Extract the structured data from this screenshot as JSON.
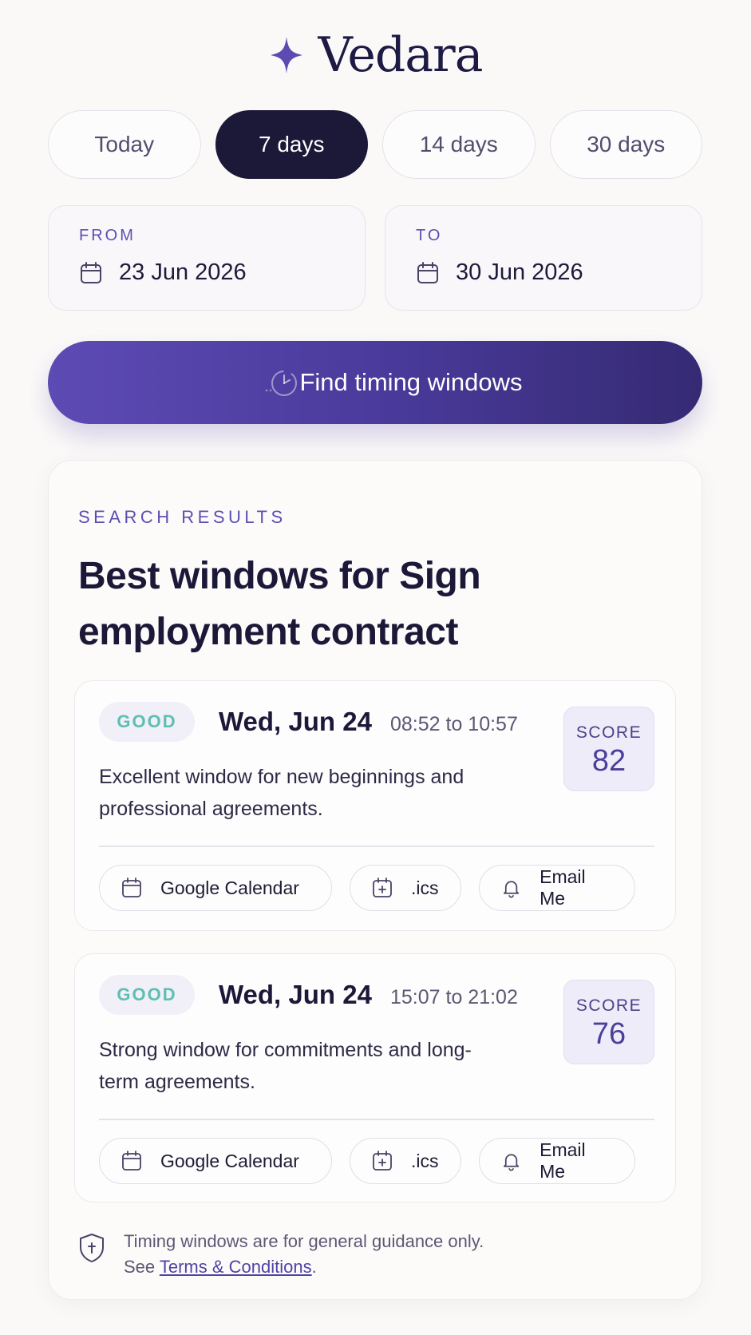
{
  "brand": {
    "name": "Vedara",
    "icon": "sparkle-star-icon",
    "accent": "#5b4bb2"
  },
  "range_tabs": [
    {
      "label": "Today",
      "active": false
    },
    {
      "label": "7 days",
      "active": true
    },
    {
      "label": "14 days",
      "active": false
    },
    {
      "label": "30 days",
      "active": false
    }
  ],
  "date_range": {
    "from": {
      "label": "FROM",
      "value": "23 Jun 2026",
      "icon": "calendar-icon"
    },
    "to": {
      "label": "TO",
      "value": "30 Jun 2026",
      "icon": "calendar-icon"
    }
  },
  "find_button": {
    "label": "Find timing windows",
    "icon": "clock-icon"
  },
  "results": {
    "eyebrow": "SEARCH RESULTS",
    "title": "Best windows for Sign employment contract",
    "windows": [
      {
        "badge": "GOOD",
        "date": "Wed, Jun 24",
        "time": "08:52 to 10:57",
        "score_label": "SCORE",
        "score": "82",
        "description": "Excellent window for new beginnings and professional agreements.",
        "actions": {
          "google": "Google Calendar",
          "ics": ".ics",
          "email": "Email Me"
        }
      },
      {
        "badge": "GOOD",
        "date": "Wed, Jun 24",
        "time": "15:07 to 21:02",
        "score_label": "SCORE",
        "score": "76",
        "description": "Strong window for commitments and long-term agreements.",
        "actions": {
          "google": "Google Calendar",
          "ics": ".ics",
          "email": "Email Me"
        }
      }
    ],
    "disclaimer": {
      "line1": "Timing windows are for general guidance only.",
      "prefix": "See ",
      "link": "Terms & Conditions",
      "suffix": "."
    }
  },
  "colors": {
    "badge_good": "#5dbfb3",
    "active_pill": "#1b1838",
    "button_gradient_start": "#5d4bb4",
    "button_gradient_end": "#352a73"
  }
}
